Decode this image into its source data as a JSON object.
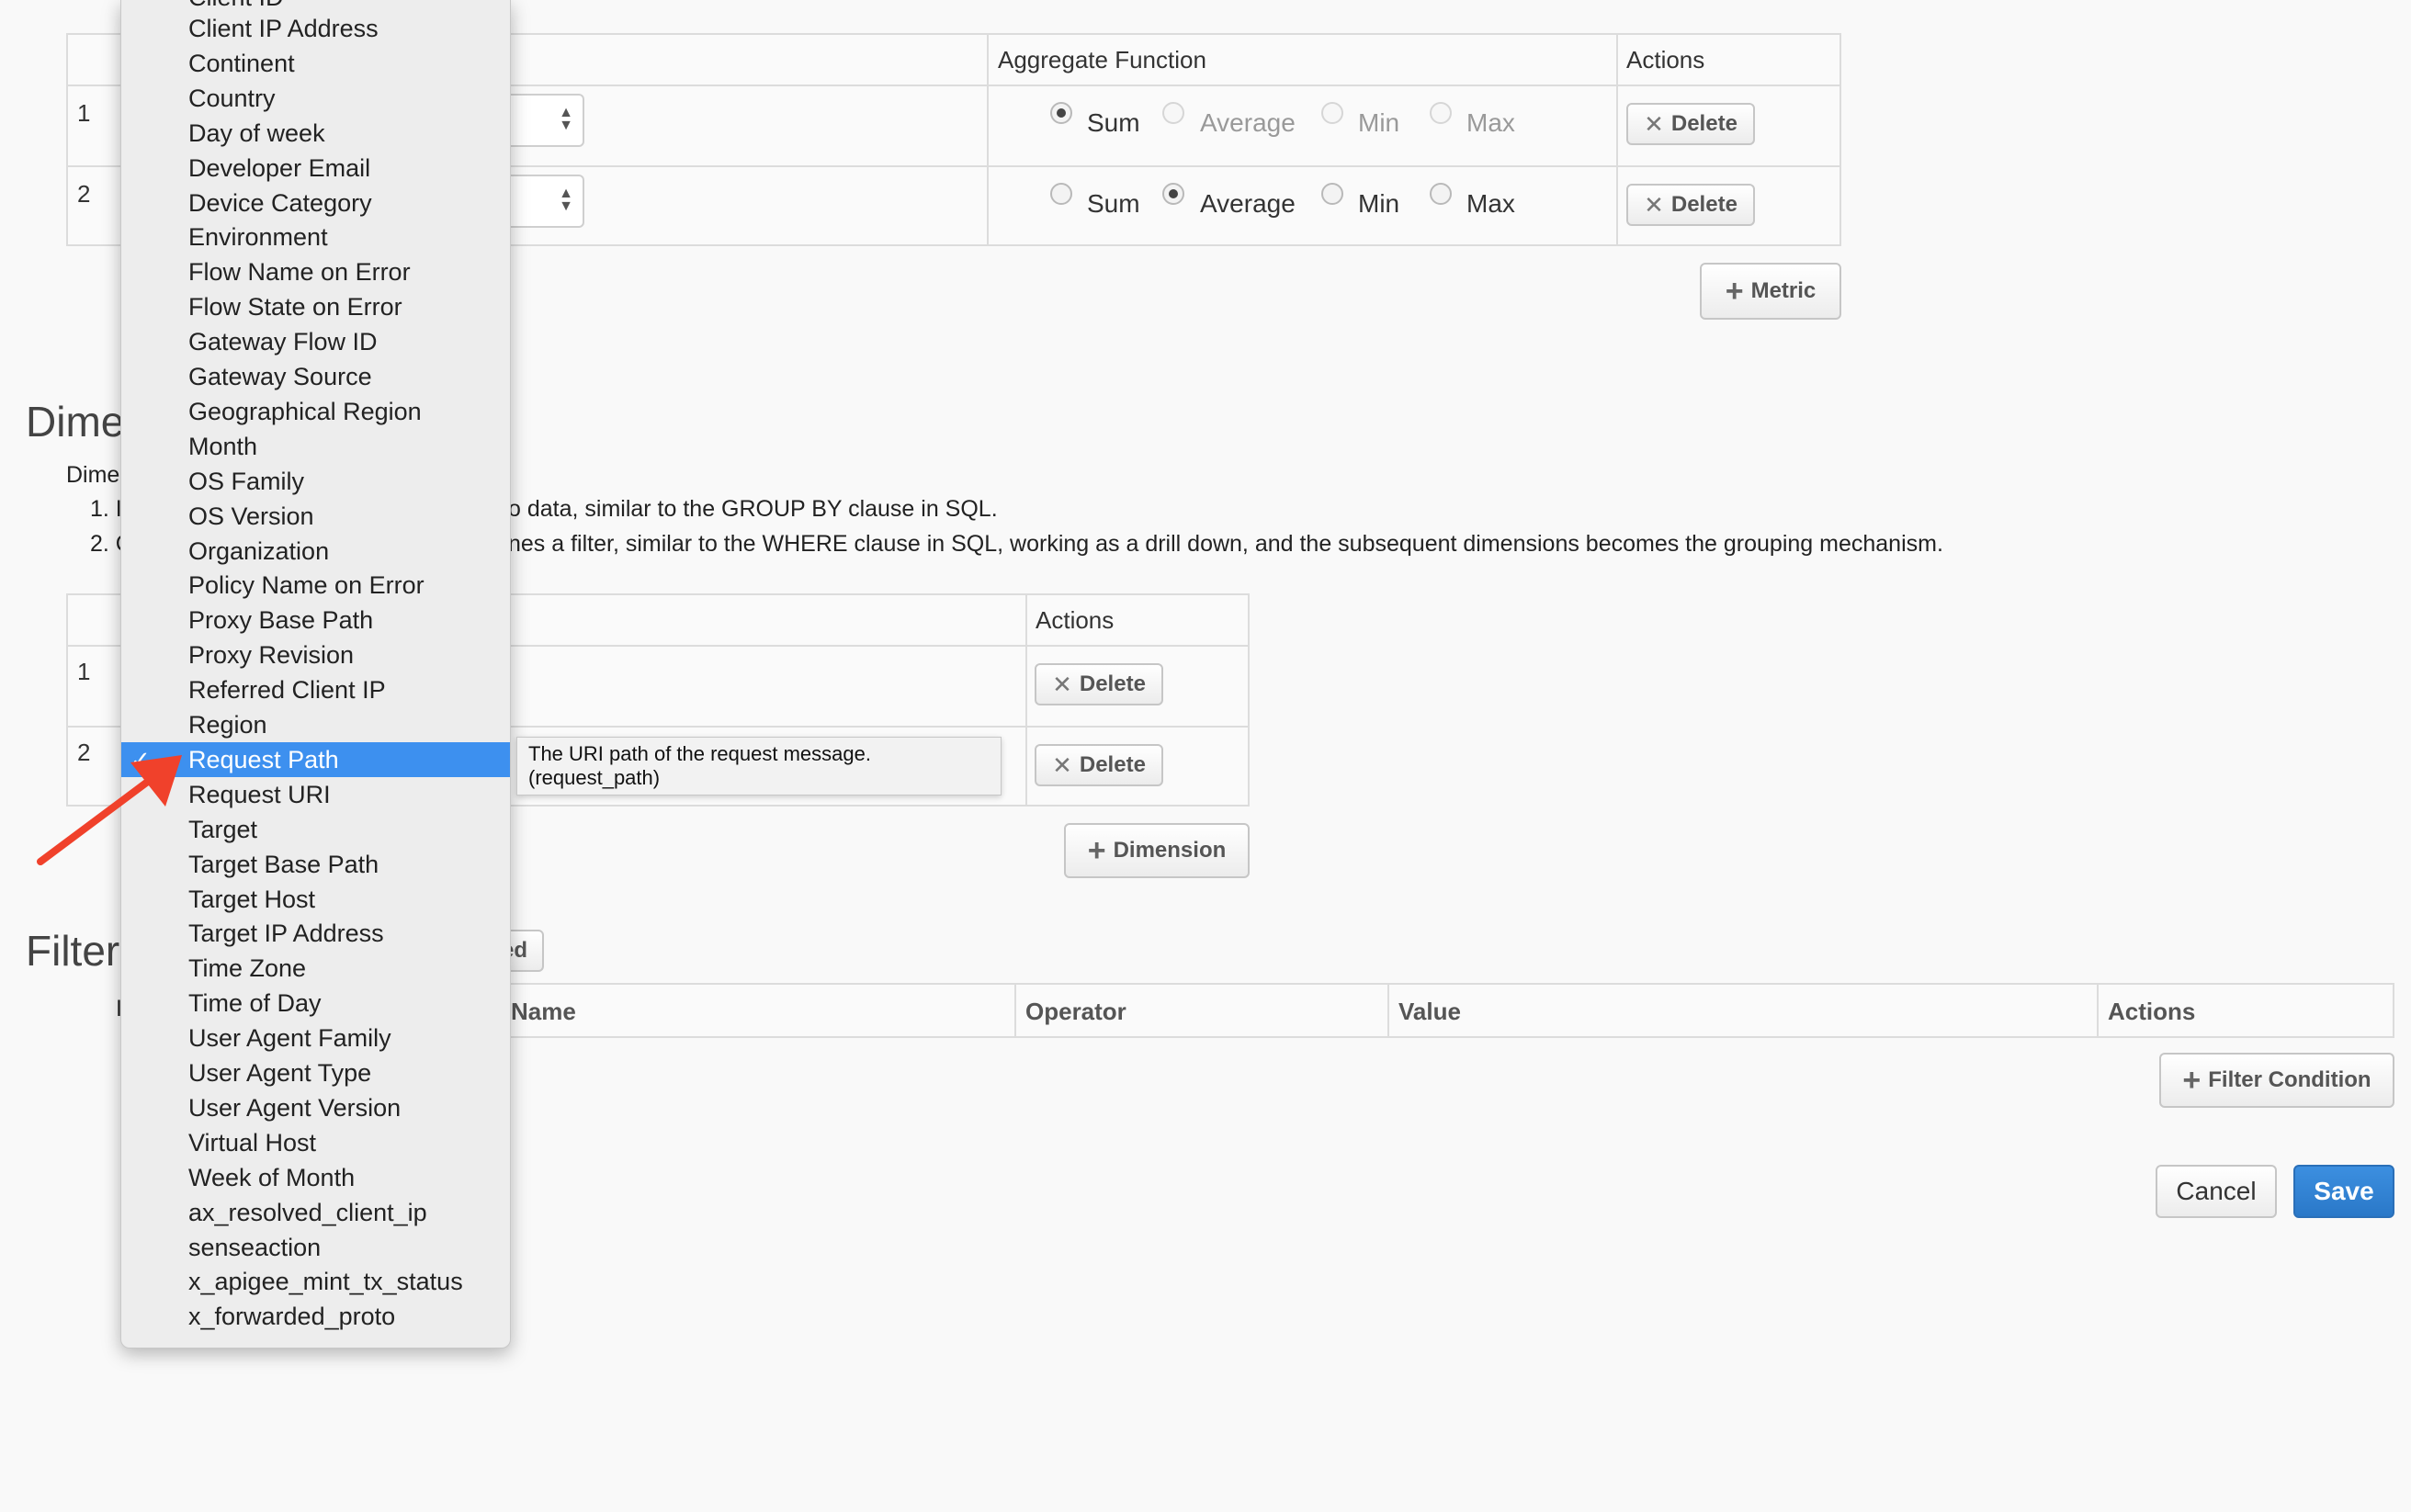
{
  "metrics_table": {
    "headers": {
      "aggregate": "Aggregate Function",
      "actions": "Actions"
    },
    "rows": [
      {
        "num": "1",
        "selected_aggregate": "Sum",
        "options": [
          "Sum",
          "Average",
          "Min",
          "Max"
        ],
        "delete_label": "Delete"
      },
      {
        "num": "2",
        "selected_aggregate": "Average",
        "options": [
          "Sum",
          "Average",
          "Min",
          "Max"
        ],
        "delete_label": "Delete"
      }
    ],
    "add_label": "Metric"
  },
  "dimensions_section": {
    "title_visible": "Dime",
    "desc_label_visible": "Dime",
    "item1_prefix": "1. I",
    "item1_text_visible": "o data, similar to the GROUP BY clause in SQL.",
    "item2_prefix": "2. C",
    "item2_text_visible": "nes a filter, similar to the WHERE clause in SQL, working as a drill down, and the subsequent dimensions becomes the grouping mechanism.",
    "table": {
      "headers": {
        "actions": "Actions"
      },
      "rows": [
        {
          "num": "1",
          "delete_label": "Delete"
        },
        {
          "num": "2",
          "delete_label": "Delete"
        }
      ]
    },
    "add_label": "Dimension"
  },
  "filters_section": {
    "title_visible": "Filter",
    "row_prefix": "I",
    "advanced_tab_visible": "ed",
    "table_headers": {
      "name_visible": "Name",
      "operator": "Operator",
      "value": "Value",
      "actions": "Actions"
    },
    "add_label": "Filter Condition"
  },
  "footer": {
    "cancel": "Cancel",
    "save": "Save"
  },
  "dropdown": {
    "top_partial": "Client ID",
    "options": [
      "Client IP Address",
      "Continent",
      "Country",
      "Day of week",
      "Developer Email",
      "Device Category",
      "Environment",
      "Flow Name on Error",
      "Flow State on Error",
      "Gateway Flow ID",
      "Gateway Source",
      "Geographical Region",
      "Month",
      "OS Family",
      "OS Version",
      "Organization",
      "Policy Name on Error",
      "Proxy Base Path",
      "Proxy Revision",
      "Referred Client IP",
      "Region",
      "Request Path",
      "Request URI",
      "Target",
      "Target Base Path",
      "Target Host",
      "Target IP Address",
      "Time Zone",
      "Time of Day",
      "User Agent Family",
      "User Agent Type",
      "User Agent Version",
      "Virtual Host",
      "Week of Month",
      "ax_resolved_client_ip",
      "senseaction",
      "x_apigee_mint_tx_status",
      "x_forwarded_proto"
    ],
    "selected": "Request Path"
  },
  "tooltip": {
    "line1": "The URI path of the request message.",
    "line2": "(request_path)"
  },
  "annotation": {
    "arrow_color": "#f0412b"
  },
  "colors": {
    "selected_bg": "#3d90ef",
    "save_bg": "#2a78c8"
  }
}
